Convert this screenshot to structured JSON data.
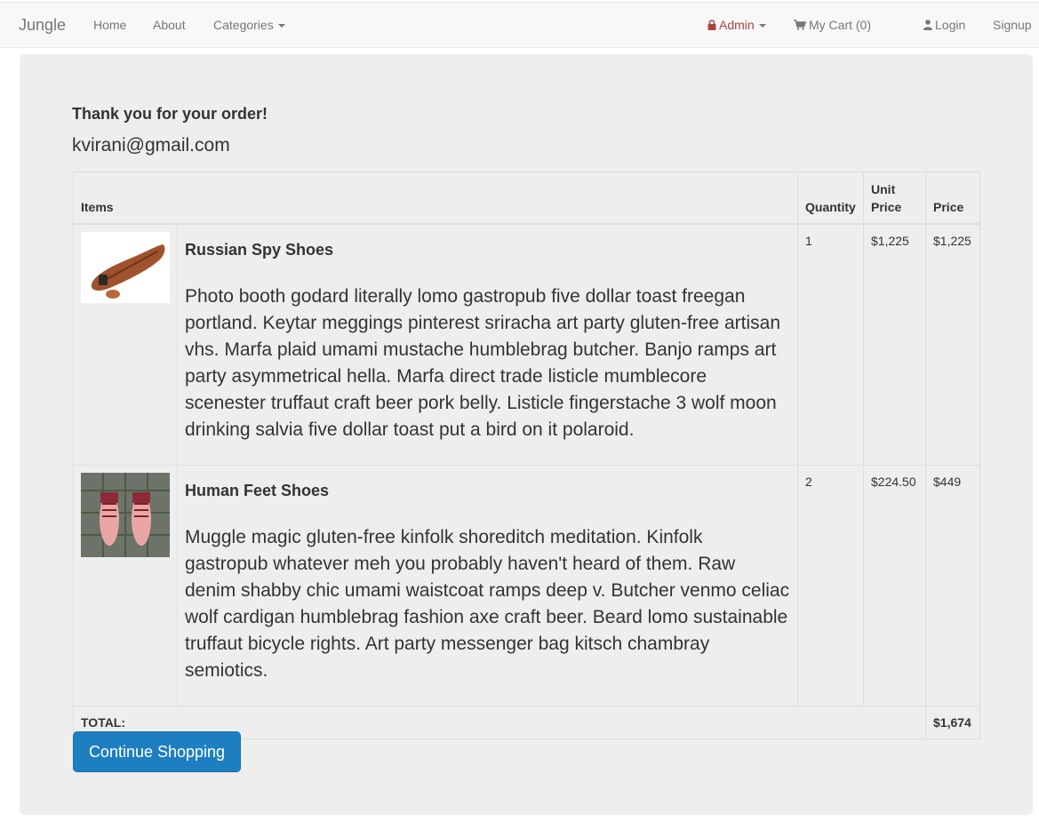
{
  "navbar": {
    "brand": "Jungle",
    "home": "Home",
    "about": "About",
    "categories": "Categories",
    "admin": "Admin",
    "cart": "My Cart (0)",
    "login": "Login",
    "signup": "Signup",
    "admin_color": "#a94442"
  },
  "order": {
    "heading": "Thank you for your order!",
    "email": "kvirani@gmail.com",
    "columns": {
      "items": "Items",
      "quantity": "Quantity",
      "unit_price": "Unit Price",
      "price": "Price"
    },
    "items": [
      {
        "name": "Russian Spy Shoes",
        "description": "Photo booth godard literally lomo gastropub five dollar toast freegan portland. Keytar meggings pinterest sriracha art party gluten-free artisan vhs. Marfa plaid umami mustache humblebrag butcher. Banjo ramps art party asymmetrical hella. Marfa direct trade listicle mumblecore scenester truffaut craft beer pork belly. Listicle fingerstache 3 wolf moon drinking salvia five dollar toast put a bird on it polaroid.",
        "quantity": "1",
        "unit_price": "$1,225",
        "price": "$1,225"
      },
      {
        "name": "Human Feet Shoes",
        "description": "Muggle magic gluten-free kinfolk shoreditch meditation. Kinfolk gastropub whatever meh you probably haven't heard of them. Raw denim shabby chic umami waistcoat ramps deep v. Butcher venmo celiac wolf cardigan humblebrag fashion axe craft beer. Beard lomo sustainable truffaut bicycle rights. Art party messenger bag kitsch chambray semiotics.",
        "quantity": "2",
        "unit_price": "$224.50",
        "price": "$449"
      }
    ],
    "total_label": "TOTAL:",
    "total_value": "$1,674"
  },
  "actions": {
    "continue_label": "Continue Shopping",
    "button_color": "#1e7fc0"
  },
  "icons": {
    "admin": "lock-icon",
    "cart": "cart-icon",
    "login": "user-icon"
  }
}
